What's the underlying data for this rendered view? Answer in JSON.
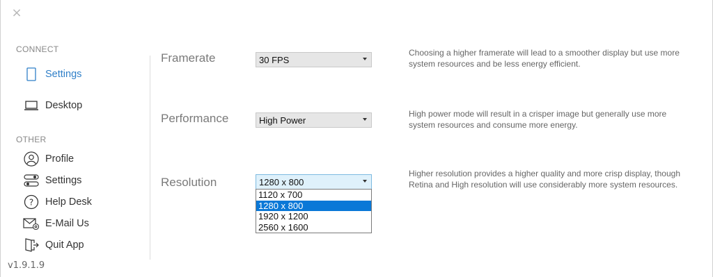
{
  "window": {
    "close_glyph": "×"
  },
  "sidebar": {
    "connect_title": "CONNECT",
    "other_title": "OTHER",
    "connect_items": [
      {
        "label": "Settings",
        "icon": "device-icon",
        "active": true
      },
      {
        "label": "Desktop",
        "icon": "laptop-icon",
        "active": false
      }
    ],
    "other_items": [
      {
        "label": "Profile",
        "icon": "user-icon"
      },
      {
        "label": "Settings",
        "icon": "sliders-icon"
      },
      {
        "label": "Help Desk",
        "icon": "help-icon"
      },
      {
        "label": "E-Mail Us",
        "icon": "mail-icon"
      },
      {
        "label": "Quit App",
        "icon": "exit-icon"
      }
    ],
    "version": "v1.9.1.9"
  },
  "settings": {
    "framerate": {
      "label": "Framerate",
      "value": "30 FPS",
      "description": "Choosing a higher framerate will lead to a smoother display but use more system resources and be less energy efficient."
    },
    "performance": {
      "label": "Performance",
      "value": "High Power",
      "description": "High power mode will result in a crisper image but generally use more system resources and consume more energy."
    },
    "resolution": {
      "label": "Resolution",
      "value": "1280 x 800",
      "description": "Higher resolution provides a higher quality and more crisp display, though Retina and High resolution will use considerably more system resources.",
      "options": [
        "1120 x 700",
        "1280 x 800",
        "1920 x 1200",
        "2560 x 1600"
      ],
      "selected_index": 1
    }
  },
  "colors": {
    "accent": "#2f7fc8",
    "selection": "#0a78d7"
  }
}
